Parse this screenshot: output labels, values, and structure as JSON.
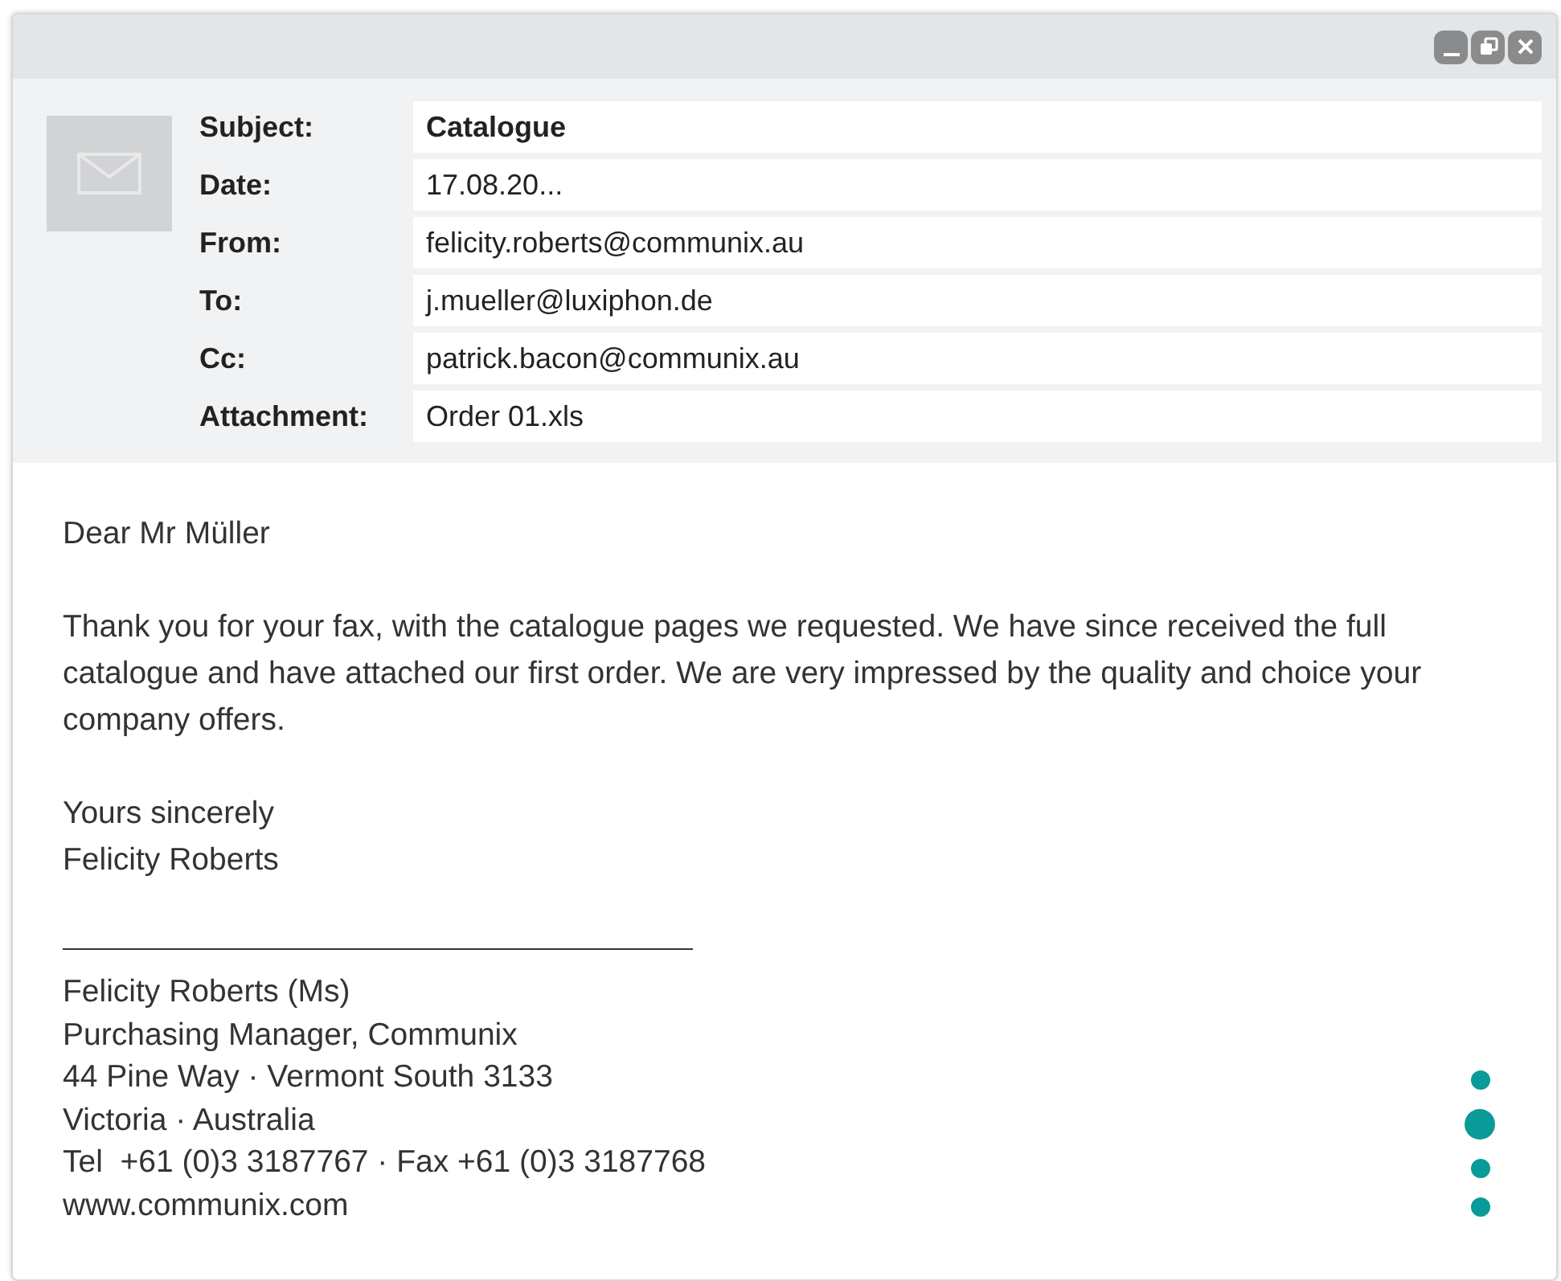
{
  "window": {
    "controls": [
      {
        "kind": "minimize"
      },
      {
        "kind": "restore"
      },
      {
        "kind": "close"
      }
    ]
  },
  "header": {
    "fields": [
      {
        "label": "Subject:",
        "value": "Catalogue",
        "kind": "subject"
      },
      {
        "label": "Date:",
        "value": "17.08.20...",
        "kind": "plain"
      },
      {
        "label": "From:",
        "value": "felicity.roberts@communix.au",
        "kind": "plain"
      },
      {
        "label": "To:",
        "value": "j.mueller@luxiphon.de",
        "kind": "plain"
      },
      {
        "label": "Cc:",
        "value": "patrick.bacon@communix.au",
        "kind": "plain"
      },
      {
        "label": "Attachment:",
        "value": "Order 01.xls",
        "kind": "plain"
      }
    ]
  },
  "body": {
    "greeting": "Dear Mr Müller",
    "paragraph": "Thank you for your fax, with the catalogue pages we requested. We have since received the full catalogue and have attached our first order. We are very impressed by the quality and choice your company offers.",
    "closing": [
      "Yours sincerely",
      "Felicity Roberts"
    ],
    "signature": [
      "Felicity Roberts (Ms)",
      "Purchasing Manager, Communix",
      "44 Pine Way · Vermont South 3133",
      "Victoria · Australia",
      "Tel  +61 (0)3 3187767 · Fax +61 (0)3 3187768",
      "www.communix.com"
    ]
  },
  "pager": [
    {
      "selected": false
    },
    {
      "selected": true
    },
    {
      "selected": false
    },
    {
      "selected": false
    }
  ]
}
